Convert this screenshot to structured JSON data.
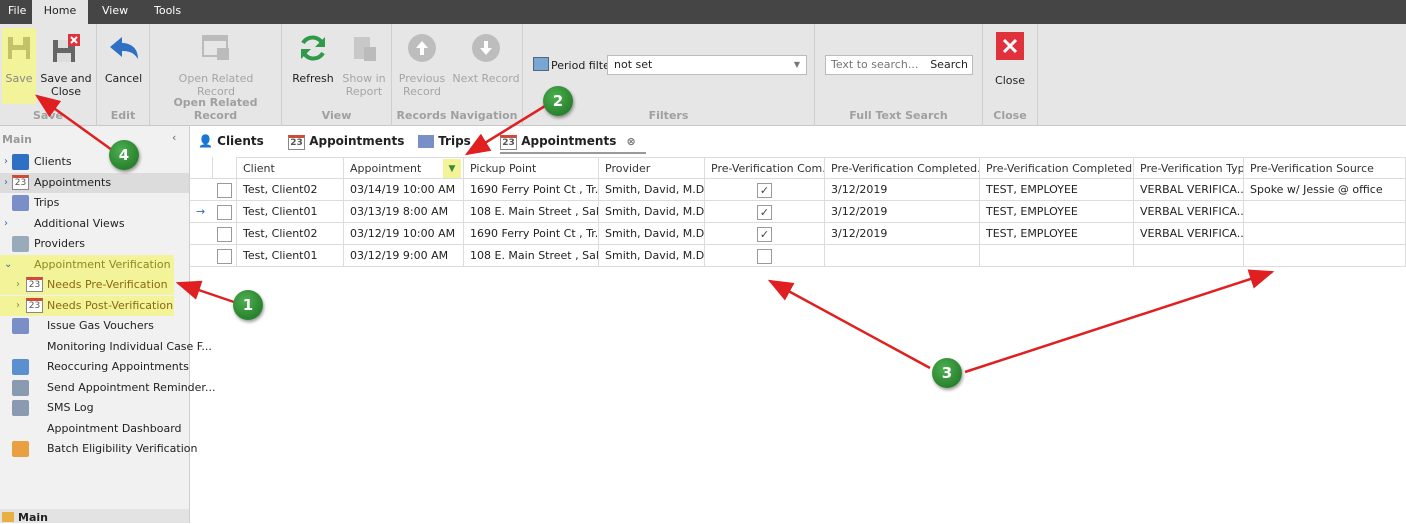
{
  "menu": {
    "file": "File",
    "home": "Home",
    "view": "View",
    "tools": "Tools"
  },
  "ribbon": {
    "save": "Save",
    "save_and_close": "Save and Close",
    "cancel": "Cancel",
    "open_related_record": "Open Related Record",
    "refresh": "Refresh",
    "show_in_report": "Show in Report",
    "previous_record": "Previous Record",
    "next_record": "Next Record",
    "period_filter_label": "Period filter",
    "period_filter_value": "not set",
    "search_placeholder": "Text to search...",
    "search_button": "Search",
    "close": "Close",
    "groups": {
      "save": "Save",
      "edit": "Edit",
      "open_related": "Open Related Record",
      "view": "View",
      "nav": "Records Navigation",
      "filters": "Filters",
      "fts": "Full Text Search",
      "close": "Close"
    }
  },
  "sidebar": {
    "title": "Main",
    "items": [
      {
        "label": "Clients"
      },
      {
        "label": "Appointments"
      },
      {
        "label": "Trips"
      },
      {
        "label": "Additional Views"
      },
      {
        "label": "Providers"
      },
      {
        "label": "Appointment Verification"
      },
      {
        "label": "Needs Pre-Verification"
      },
      {
        "label": "Needs Post-Verification"
      },
      {
        "label": "Issue Gas Vouchers"
      },
      {
        "label": "Monitoring Individual Case F..."
      },
      {
        "label": "Reoccuring Appointments"
      },
      {
        "label": "Send Appointment Reminder..."
      },
      {
        "label": "SMS Log"
      },
      {
        "label": "Appointment Dashboard"
      },
      {
        "label": "Batch Eligibility Verification"
      }
    ],
    "footer": "Main"
  },
  "tabs": [
    {
      "label": "Clients"
    },
    {
      "label": "Appointments"
    },
    {
      "label": "Trips"
    },
    {
      "label": "Appointments"
    }
  ],
  "grid": {
    "columns": [
      "Client",
      "Appointment",
      "Pickup Point",
      "Provider",
      "Pre-Verification Com...",
      "Pre-Verification Completed...",
      "Pre-Verification Completed By",
      "Pre-Verification Type",
      "Pre-Verification Source"
    ],
    "rows": [
      {
        "client": "Test, Client02",
        "appointment": "03/14/19 10:00 AM",
        "pickup": "1690 Ferry Point Ct , Tr...",
        "provider": "Smith, David, M.D.",
        "completed": true,
        "completed_date": "3/12/2019",
        "completed_by": "TEST, EMPLOYEE",
        "type": "VERBAL VERIFICA...",
        "source": "Spoke w/ Jessie @ office"
      },
      {
        "client": "Test, Client01",
        "appointment": "03/13/19 8:00 AM",
        "pickup": "108 E. Main Street , Sal...",
        "provider": "Smith, David, M.D.",
        "completed": true,
        "completed_date": "3/12/2019",
        "completed_by": "TEST, EMPLOYEE",
        "type": "VERBAL VERIFICA...",
        "source": ""
      },
      {
        "client": "Test, Client02",
        "appointment": "03/12/19 10:00 AM",
        "pickup": "1690 Ferry Point Ct , Tr...",
        "provider": "Smith, David, M.D.",
        "completed": true,
        "completed_date": "3/12/2019",
        "completed_by": "TEST, EMPLOYEE",
        "type": "VERBAL VERIFICA...",
        "source": ""
      },
      {
        "client": "Test, Client01",
        "appointment": "03/12/19 9:00 AM",
        "pickup": "108 E. Main Street , Sal...",
        "provider": "Smith, David, M.D.",
        "completed": false,
        "completed_date": "",
        "completed_by": "",
        "type": "",
        "source": ""
      }
    ]
  },
  "annotations": {
    "one": "1",
    "two": "2",
    "three": "3",
    "four": "4"
  },
  "colors": {
    "highlight": "#f3f39a",
    "accent": "#2a6db5",
    "arrow": "#e02020",
    "close": "#e0323c"
  }
}
